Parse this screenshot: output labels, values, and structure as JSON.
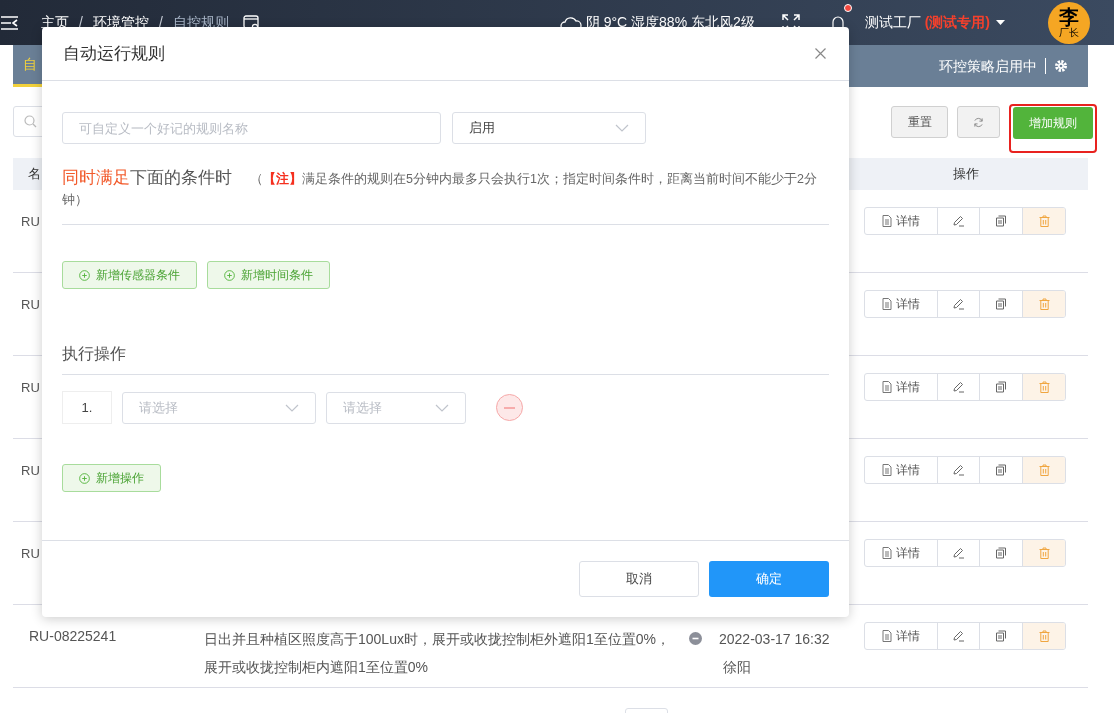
{
  "header": {
    "breadcrumb": [
      {
        "label": "主页",
        "current": false
      },
      {
        "label": "环境管控",
        "current": false
      },
      {
        "label": "自控规则",
        "current": true
      }
    ],
    "separator": "/",
    "weather": "阴 9°C 湿度88% 东北风2级",
    "notifications_unread": true,
    "factory": {
      "name": "测试工厂",
      "tag": "(测试专用)"
    },
    "avatar": {
      "surname": "李",
      "role": "厂长"
    }
  },
  "subbar": {
    "tabs": [
      {
        "label": "自",
        "selected": true
      }
    ],
    "status": "环控策略启用中"
  },
  "toolbar": {
    "buttons": [
      {
        "kind": "plain",
        "label": "重置",
        "highlighted": false
      },
      {
        "kind": "refresh",
        "highlighted": false
      },
      {
        "kind": "primary",
        "label": "增加规则",
        "highlighted": true
      }
    ]
  },
  "table": {
    "column_1": "名",
    "actions_column": "操作",
    "rows": [
      {
        "name": "RU",
        "detail_label": "详情"
      },
      {
        "name": "RU",
        "detail_label": "详情"
      },
      {
        "name": "RU",
        "detail_label": "详情"
      },
      {
        "name": "RU",
        "detail_label": "详情"
      },
      {
        "name": "RU",
        "detail_label": "详情"
      },
      {
        "name": "RU-08225241",
        "description": "日出并且种植区照度高于100Lux时，展开或收拢控制柜外遮阳1至位置0%，展开或收拢控制柜内遮阳1至位置0%",
        "enabled": false,
        "time": "2022-03-17 16:32",
        "author": "徐阳",
        "detail_label": "详情"
      }
    ]
  },
  "modal": {
    "title": "自动运行规则",
    "name_field": {
      "placeholder": "可自定义一个好记的规则名称"
    },
    "state_select": {
      "value": "启用"
    },
    "conditions": {
      "highlight": "同时满足",
      "rest": "下面的条件时",
      "note": {
        "open": "（",
        "tag": "【注】",
        "body": "满足条件的规则在5分钟内最多只会执行1次；指定时间条件时，距离当前时间不能少于2分钟",
        "close": "）"
      },
      "buttons": [
        "新增传感器条件",
        "新增时间条件"
      ]
    },
    "actions": {
      "title": "执行操作",
      "rows": [
        {
          "index": "1.",
          "device_placeholder": "请选择",
          "action_placeholder": "请选择"
        }
      ],
      "add_label": "新增操作"
    },
    "footer": {
      "cancel": "取消",
      "confirm": "确定"
    }
  }
}
